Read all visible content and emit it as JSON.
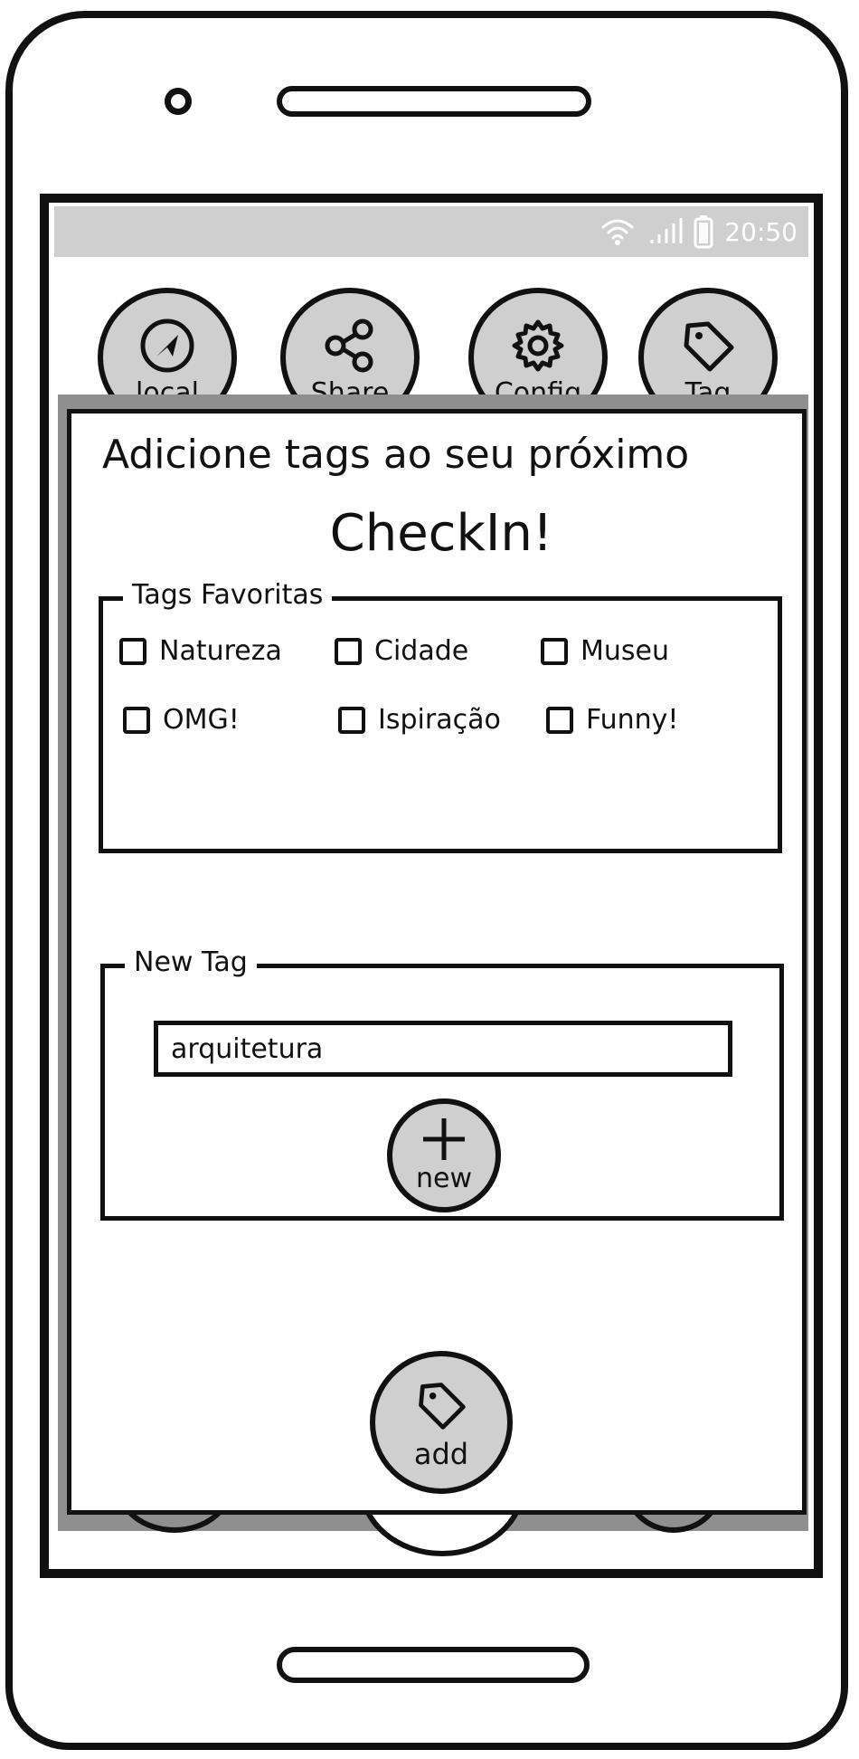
{
  "status_bar": {
    "time": "20:50"
  },
  "nav": [
    {
      "label": "local",
      "icon": "navigation-arrow-icon"
    },
    {
      "label": "Share",
      "icon": "share-icon"
    },
    {
      "label": "Config",
      "icon": "gear-icon"
    },
    {
      "label": "Tag",
      "icon": "tag-icon"
    }
  ],
  "dialog": {
    "title": "Adicione tags ao seu próximo",
    "subtitle": "CheckIn!",
    "favorites": {
      "legend": "Tags Favoritas",
      "tags": [
        {
          "label": "Natureza",
          "checked": false
        },
        {
          "label": "Cidade",
          "checked": false
        },
        {
          "label": "Museu",
          "checked": false
        },
        {
          "label": "OMG!",
          "checked": false
        },
        {
          "label": "Ispiração",
          "checked": false
        },
        {
          "label": "Funny!",
          "checked": false
        }
      ]
    },
    "new_tag": {
      "legend": "New Tag",
      "input_value": "arquitetura",
      "new_button_label": "new"
    },
    "add_button_label": "add"
  },
  "colors": {
    "button_fill": "#cfcfcf",
    "overlay": "#8f8f8f",
    "outline": "#111111"
  }
}
